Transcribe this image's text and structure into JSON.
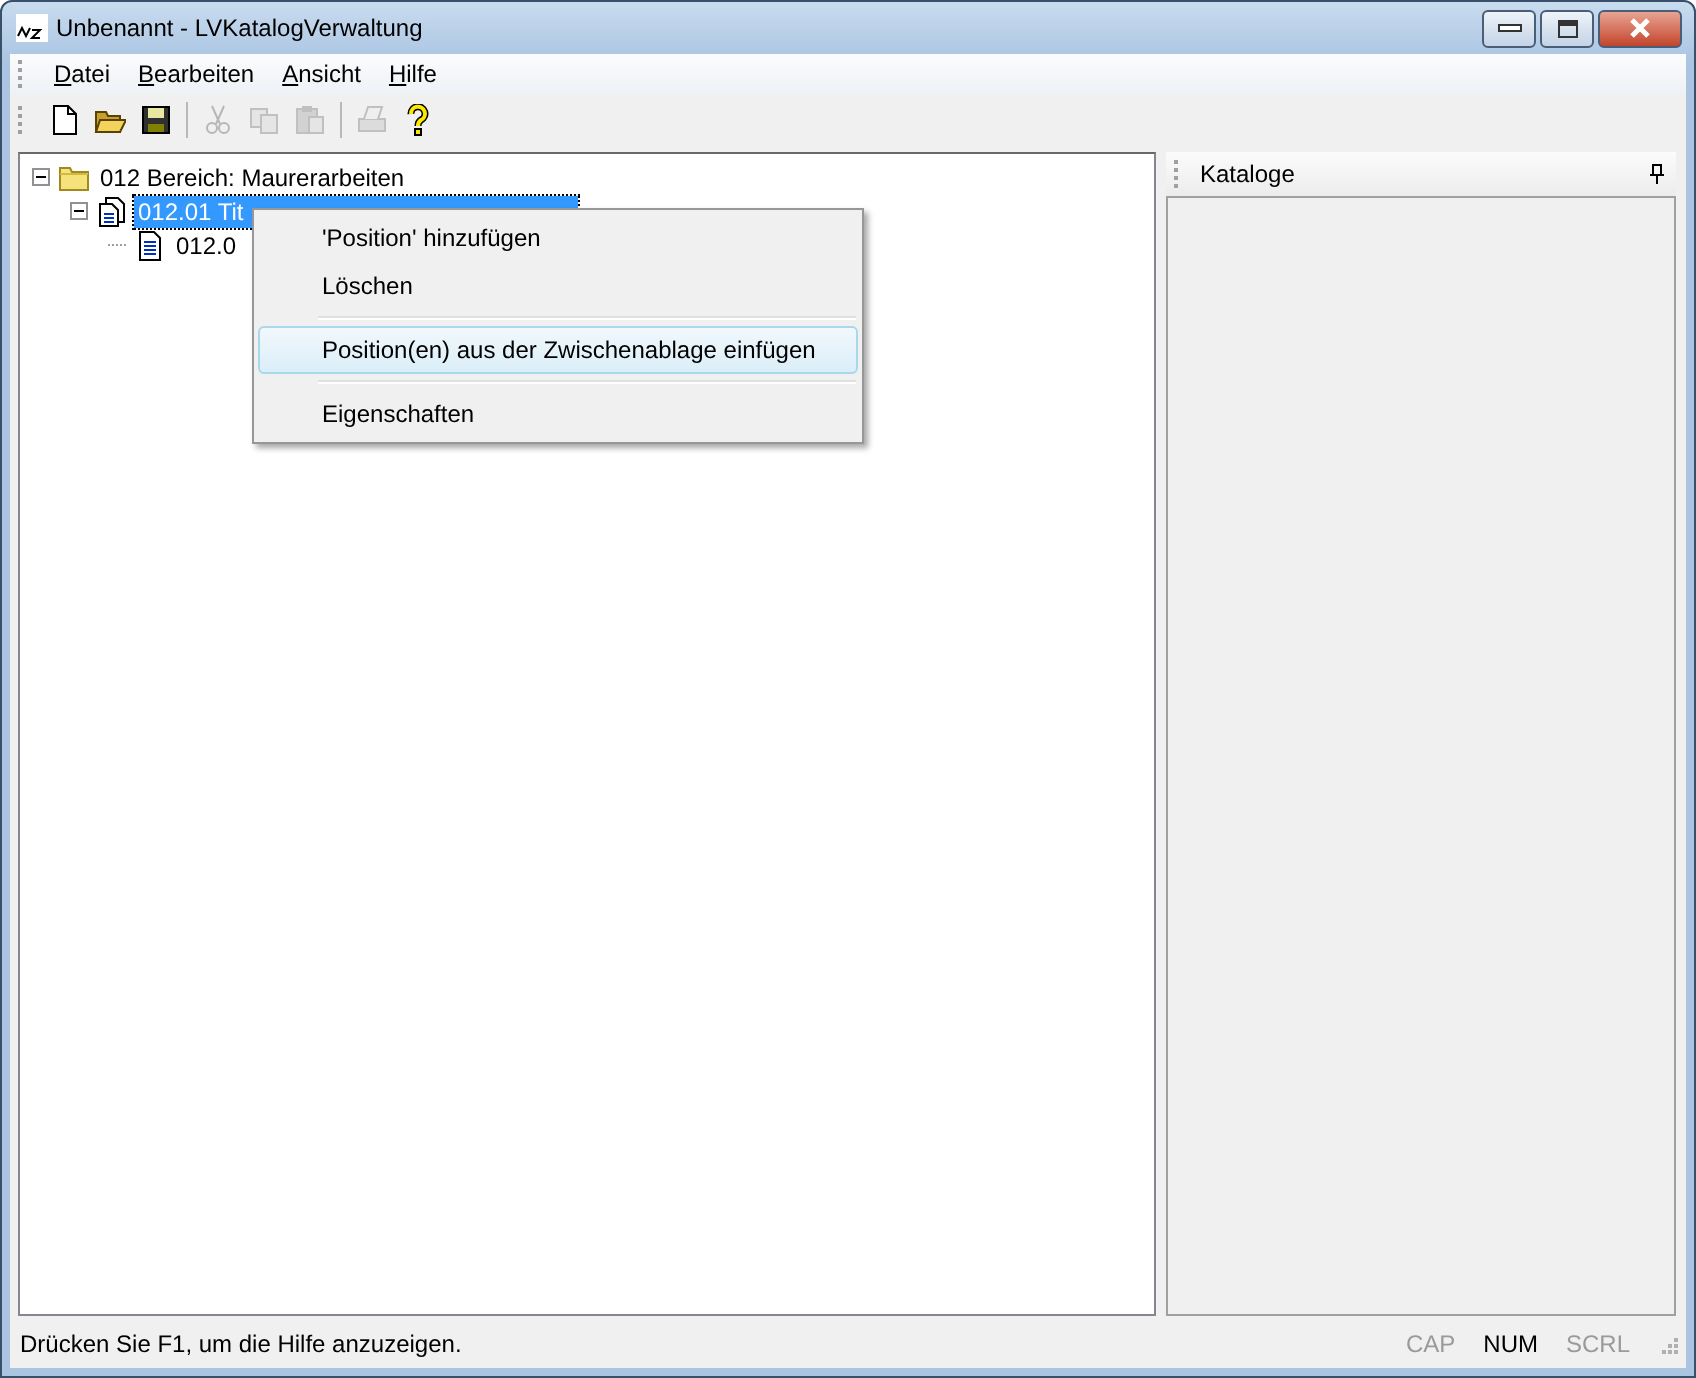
{
  "window": {
    "title": "Unbenannt - LVKatalogVerwaltung"
  },
  "menu_bar": [
    {
      "label": "Datei"
    },
    {
      "label": "Bearbeiten"
    },
    {
      "label": "Ansicht"
    },
    {
      "label": "Hilfe"
    }
  ],
  "toolbar": [
    {
      "kind": "new",
      "disabled": false
    },
    {
      "kind": "open",
      "disabled": false
    },
    {
      "kind": "save",
      "disabled": false
    },
    {
      "kind": "separator"
    },
    {
      "kind": "cut",
      "disabled": true
    },
    {
      "kind": "copy",
      "disabled": true
    },
    {
      "kind": "paste",
      "disabled": true
    },
    {
      "kind": "separator"
    },
    {
      "kind": "print",
      "disabled": true
    },
    {
      "kind": "help",
      "disabled": false
    }
  ],
  "tree": [
    {
      "label": "012 Bereich: Maurerarbeiten",
      "kind": "folder",
      "expanded": true,
      "selected": false,
      "children": [
        {
          "label": "012.01 Tit",
          "kind": "title",
          "expanded": true,
          "selected": true,
          "children": [
            {
              "label": "012.0",
              "kind": "position",
              "selected": false
            }
          ]
        }
      ]
    }
  ],
  "context_menu": [
    {
      "kind": "item",
      "label": "'Position' hinzufügen",
      "selected": false
    },
    {
      "kind": "item",
      "label": "Löschen",
      "selected": false
    },
    {
      "kind": "separator"
    },
    {
      "kind": "item",
      "label": "Position(en) aus der Zwischenablage einfügen",
      "selected": true
    },
    {
      "kind": "separator"
    },
    {
      "kind": "item",
      "label": "Eigenschaften",
      "selected": false
    }
  ],
  "side_panel": {
    "title": "Kataloge"
  },
  "status_bar": {
    "message": "Drücken Sie F1, um die Hilfe anzuzeigen.",
    "indicators": [
      {
        "label": "CAP",
        "on": false
      },
      {
        "label": "NUM",
        "on": true
      },
      {
        "label": "SCRL",
        "on": false
      }
    ]
  }
}
